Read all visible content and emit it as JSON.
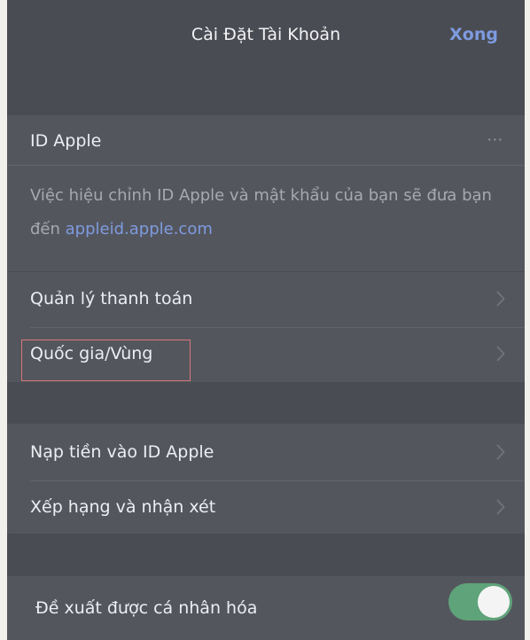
{
  "header": {
    "title": "Cài Đặt Tài Khoản",
    "done_label": "Xong"
  },
  "apple_id": {
    "label": "ID Apple",
    "menu_glyph": "···",
    "description": "Việc hiệu chỉnh ID Apple và mật khẩu của bạn sẽ đưa bạn đến ",
    "link": "appleid.apple.com"
  },
  "rows": [
    {
      "label": "Quản lý thanh toán",
      "icon": "chevron-right-icon"
    },
    {
      "label": "Quốc gia/Vùng",
      "icon": "chevron-right-icon"
    },
    {
      "label": "Nạp tiền vào ID Apple",
      "icon": "chevron-right-icon"
    },
    {
      "label": "Xếp hạng và nhận xét",
      "icon": "chevron-right-icon"
    }
  ],
  "personalized": {
    "label": "Đề xuất được cá nhân hóa",
    "enabled": true
  },
  "colors": {
    "accent": "#7e9be0",
    "toggle_on": "#5fa37a",
    "highlight": "#d6767a"
  }
}
